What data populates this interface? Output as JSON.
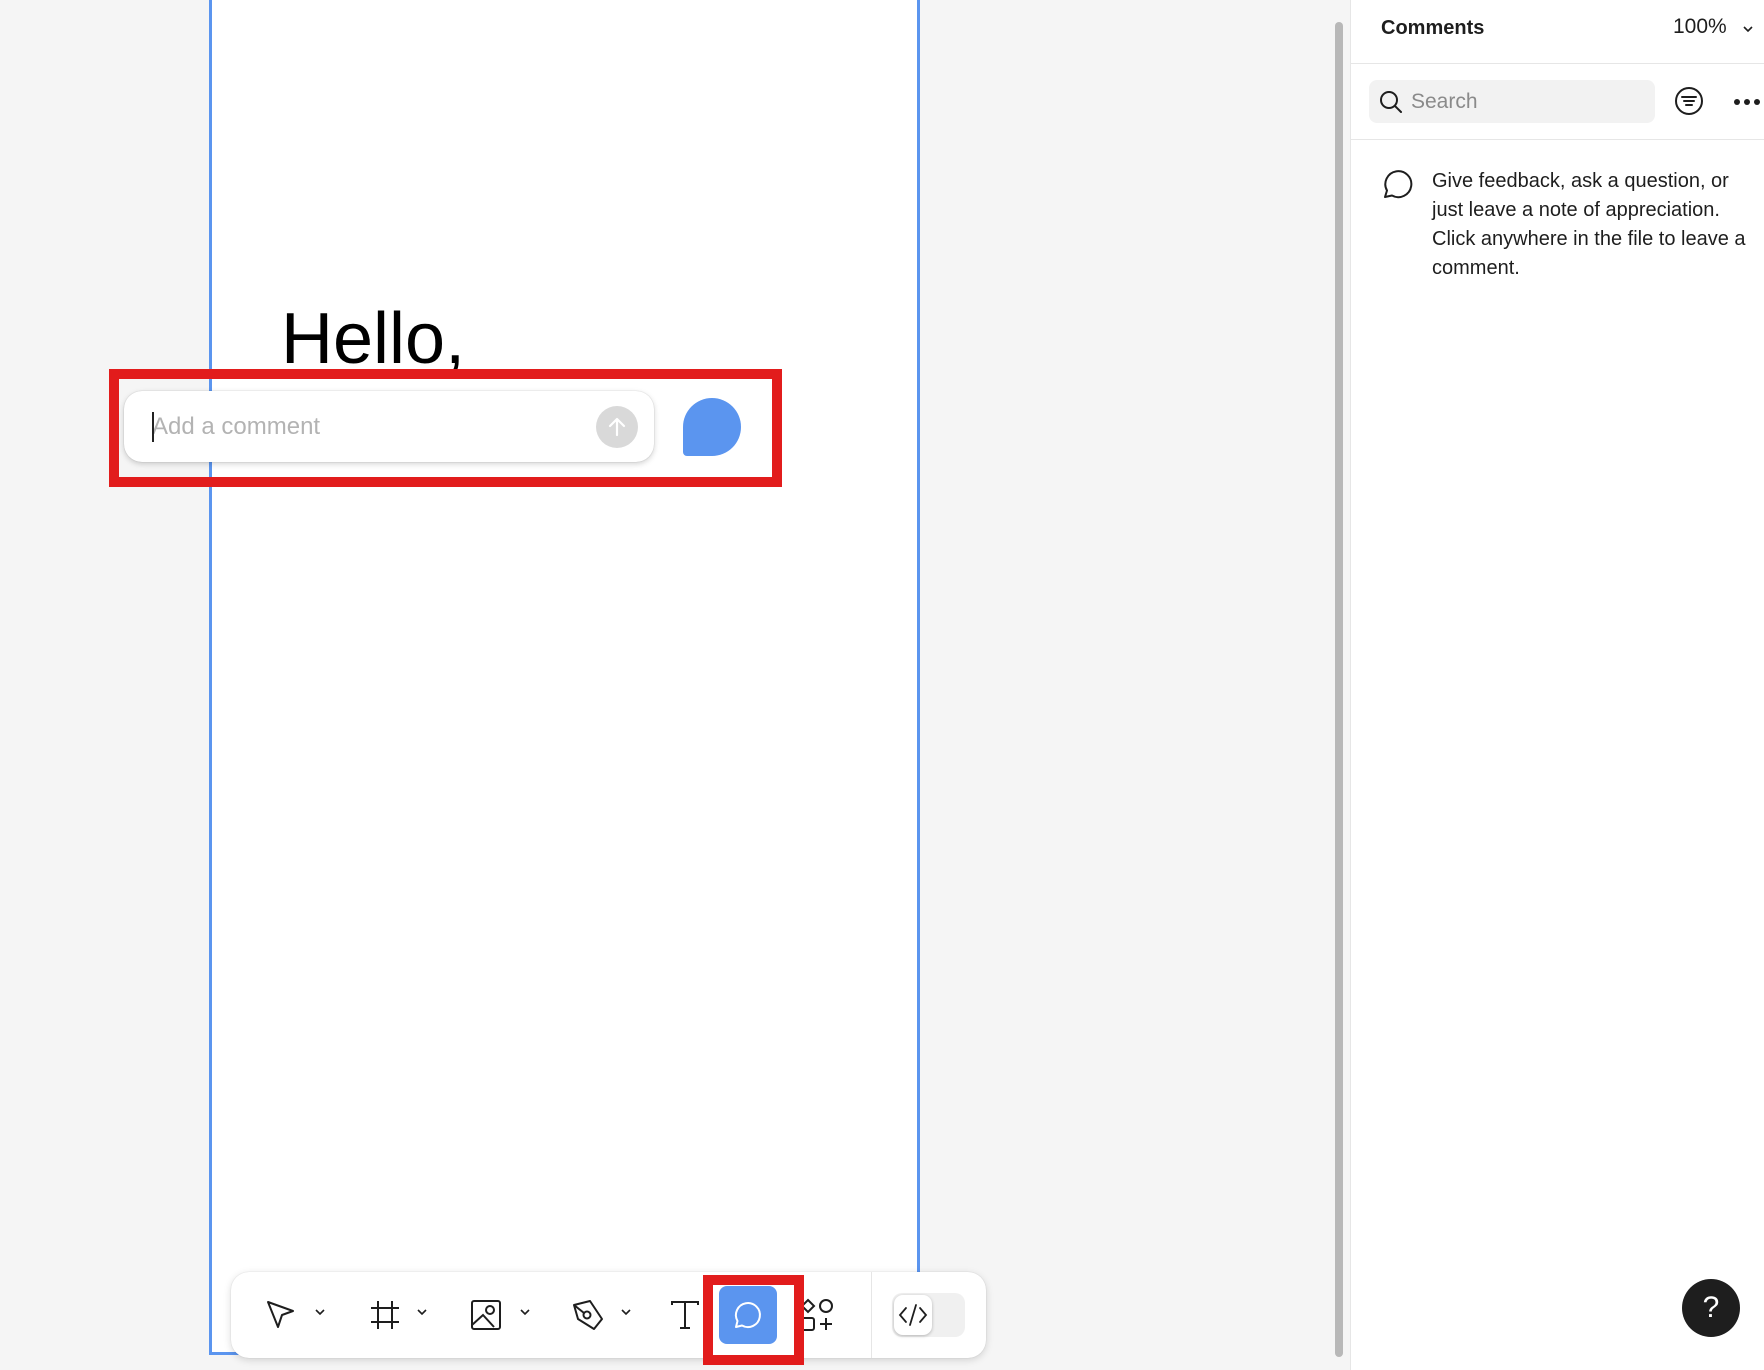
{
  "canvas": {
    "frame_text": "Hello,",
    "composer": {
      "placeholder": "Add a comment",
      "value": ""
    },
    "accent_color": "#5b95ef",
    "annotation_color": "#e21c1c"
  },
  "toolbar": {
    "tools": [
      {
        "name": "move-tool",
        "icon": "cursor-arrow-icon",
        "has_dropdown": true
      },
      {
        "name": "frame-tool",
        "icon": "frame-hash-icon",
        "has_dropdown": true
      },
      {
        "name": "image-tool",
        "icon": "image-icon",
        "has_dropdown": true
      },
      {
        "name": "pen-tool",
        "icon": "pen-nib-icon",
        "has_dropdown": true
      },
      {
        "name": "text-tool",
        "icon": "text-t-icon",
        "has_dropdown": false
      },
      {
        "name": "comment-tool",
        "icon": "comment-bubble-icon",
        "has_dropdown": false,
        "active": true
      },
      {
        "name": "assets-tool",
        "icon": "shapes-plus-icon",
        "has_dropdown": false
      }
    ],
    "dev_mode_icon": "code-brackets-icon"
  },
  "panel": {
    "title": "Comments",
    "zoom": "100%",
    "search": {
      "placeholder": "Search",
      "value": ""
    },
    "empty_state": "Give feedback, ask a question, or just leave a note of appreciation. Click anywhere in the file to leave a comment."
  },
  "help": {
    "label": "?"
  }
}
